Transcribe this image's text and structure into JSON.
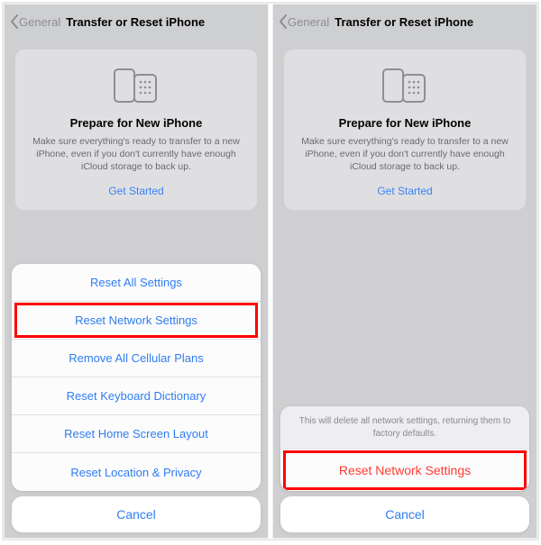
{
  "nav": {
    "back": "General",
    "title": "Transfer or Reset iPhone"
  },
  "card": {
    "heading": "Prepare for New iPhone",
    "body": "Make sure everything's ready to transfer to a new iPhone, even if you don't currently have enough iCloud storage to back up.",
    "cta": "Get Started"
  },
  "sheet_left": {
    "options": [
      "Reset All Settings",
      "Reset Network Settings",
      "Remove All Cellular Plans",
      "Reset Keyboard Dictionary",
      "Reset Home Screen Layout",
      "Reset Location & Privacy"
    ]
  },
  "sheet_right": {
    "message": "This will delete all network settings, returning them to factory defaults.",
    "confirm": "Reset Network Settings"
  },
  "cancel": "Cancel"
}
